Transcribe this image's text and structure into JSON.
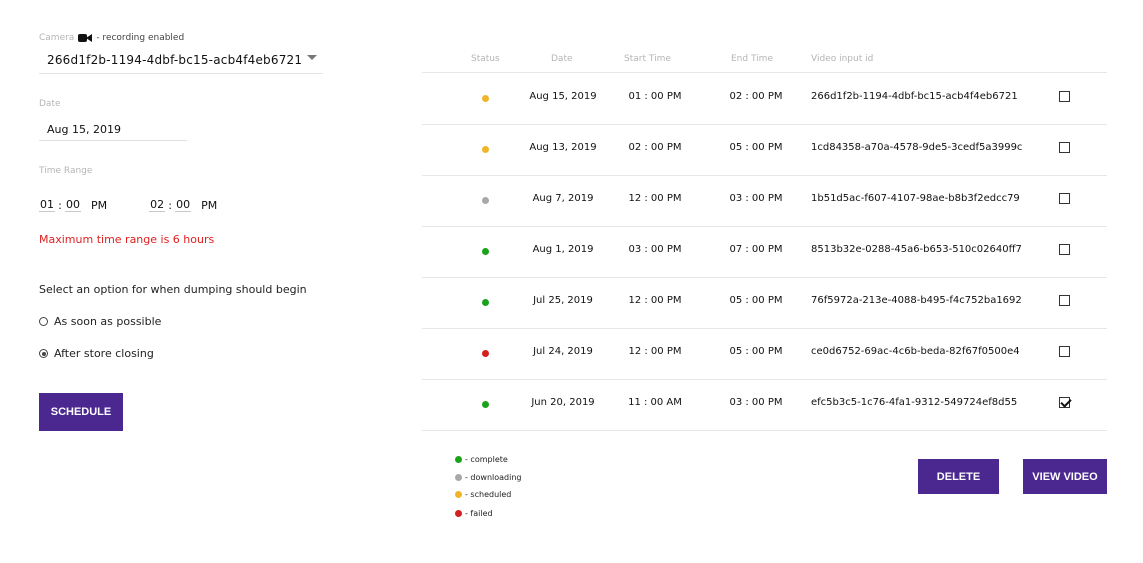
{
  "camera": {
    "label": "Camera",
    "recording_text": "- recording enabled",
    "selected": "266d1f2b-1194-4dbf-bc15-acb4f4eb6721"
  },
  "date": {
    "label": "Date",
    "value": "Aug 15, 2019"
  },
  "time_range": {
    "label": "Time Range",
    "start_hour": "01",
    "start_min": "00",
    "start_ampm": "PM",
    "end_hour": "02",
    "end_min": "00",
    "end_ampm": "PM",
    "colon": ":",
    "warning": "Maximum time range is 6 hours"
  },
  "dump": {
    "question": "Select an option for when dumping should begin",
    "options": [
      "As soon as possible",
      "After store closing"
    ],
    "selected_index": 1
  },
  "buttons": {
    "schedule": "SCHEDULE",
    "delete": "DELETE",
    "view_video": "VIEW VIDEO"
  },
  "table": {
    "headers": [
      "Status",
      "Date",
      "Start Time",
      "End Time",
      "Video input id"
    ],
    "rows": [
      {
        "status": "scheduled",
        "date": "Aug 15, 2019",
        "start": "01 : 00 PM",
        "end": "02 : 00 PM",
        "id": "266d1f2b-1194-4dbf-bc15-acb4f4eb6721",
        "checked": false
      },
      {
        "status": "scheduled",
        "date": "Aug 13, 2019",
        "start": "02 : 00 PM",
        "end": "05 : 00 PM",
        "id": "1cd84358-a70a-4578-9de5-3cedf5a3999c",
        "checked": false
      },
      {
        "status": "downloading",
        "date": "Aug 7, 2019",
        "start": "12 : 00 PM",
        "end": "03 : 00 PM",
        "id": "1b51d5ac-f607-4107-98ae-b8b3f2edcc79",
        "checked": false
      },
      {
        "status": "complete",
        "date": "Aug 1, 2019",
        "start": "03 : 00 PM",
        "end": "07 : 00 PM",
        "id": "8513b32e-0288-45a6-b653-510c02640ff7",
        "checked": false
      },
      {
        "status": "complete",
        "date": "Jul 25, 2019",
        "start": "12 : 00 PM",
        "end": "05 : 00 PM",
        "id": "76f5972a-213e-4088-b495-f4c752ba1692",
        "checked": false
      },
      {
        "status": "failed",
        "date": "Jul 24, 2019",
        "start": "12 : 00 PM",
        "end": "05 : 00 PM",
        "id": "ce0d6752-69ac-4c6b-beda-82f67f0500e4",
        "checked": false
      },
      {
        "status": "complete",
        "date": "Jun 20, 2019",
        "start": "11 : 00 AM",
        "end": "03 : 00 PM",
        "id": "efc5b3c5-1c76-4fa1-9312-549724ef8d55",
        "checked": true
      }
    ]
  },
  "legend": [
    {
      "key": "complete",
      "label": "- complete",
      "color": "#1aa31a"
    },
    {
      "key": "downloading",
      "label": "- downloading",
      "color": "#a8a8a8"
    },
    {
      "key": "scheduled",
      "label": "- scheduled",
      "color": "#f0b429"
    },
    {
      "key": "failed",
      "label": "- failed",
      "color": "#d42020"
    }
  ],
  "colors": {
    "accent": "#4b2790",
    "warning": "#e02020"
  }
}
